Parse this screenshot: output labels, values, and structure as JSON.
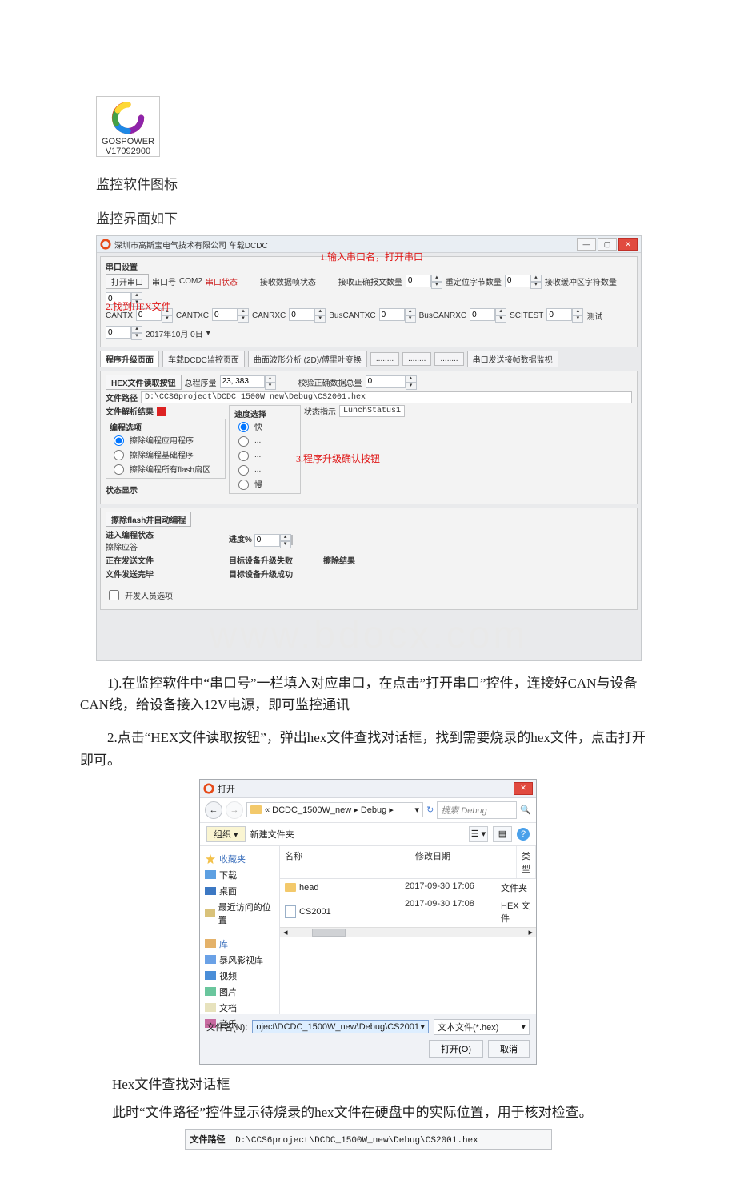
{
  "icon_card": {
    "name": "GOSPOWER",
    "version": "V17092900"
  },
  "headings": {
    "icon_caption": "监控软件图标",
    "ui_caption": "监控界面如下"
  },
  "app": {
    "title": "深圳市高斯宝电气技术有限公司 车载DCDC",
    "serial_group": "串口设置",
    "open_serial": "打开串口",
    "port_label": "串口号",
    "port_value": "COM2",
    "status_label": "串口状态",
    "rx_status": "接收数据帧状态",
    "rx_ok_bytes_lbl": "接收正确报文数量",
    "rx_ok_bytes_val": "0",
    "pos_bytes_lbl": "重定位字节数量",
    "pos_bytes_val": "0",
    "rx_buf_lbl": "接收缓冲区字符数量",
    "rx_buf_val": "0",
    "cantx_lbl": "CANTX",
    "cantx_val": "0",
    "cantxc_lbl": "CANTXC",
    "cantxc_val": "0",
    "canrxc_lbl": "CANRXC",
    "canrxc_val": "0",
    "buscantxc_lbl": "BusCANTXC",
    "buscantxc_val": "0",
    "buscanrxc_lbl": "BusCANRXC",
    "buscanrxc_val": "0",
    "scitest_lbl": "SCITEST",
    "scitest_val": "0",
    "test_lbl": "测试",
    "test_val": "0",
    "date_lbl": "2017年10月 0日",
    "tabs": [
      "程序升级页面",
      "车载DCDC监控页面",
      "曲面波形分析 (2D)/傅里叶变换",
      "........",
      "........",
      "........",
      "串口发送接帧数据监视"
    ],
    "hex_btn": "HEX文件读取按钮",
    "total_bytes_lbl": "总程序量",
    "total_bytes_val": "23, 383",
    "verify_ok_lbl": "校验正确数据总量",
    "verify_ok_val": "0",
    "file_path_lbl": "文件路径",
    "file_path_val": "D:\\CCS6project\\DCDC_1500W_new\\Debug\\CS2001.hex",
    "parse_result_lbl": "文件解析结果",
    "prog_select_grp": "编程选项",
    "opt_erase_app": "擦除编程应用程序",
    "opt_erase_base": "擦除编程基础程序",
    "opt_erase_all": "擦除编程所有flash扇区",
    "speed_grp": "速度选择",
    "speed_fast": "快",
    "speed_ellipsis": "...",
    "speed_slow": "慢",
    "state_lbl": "状态指示",
    "state_val": "LunchStatus1",
    "state_display": "状态显示",
    "confirm_btn": "擦除flash并自动编程",
    "enter_state": "进入编程状态",
    "erase_resp": "擦除应答",
    "sending": "正在发送文件",
    "send_done": "文件发送完毕",
    "fail": "目标设备升级失败",
    "fail_res": "擦除结果",
    "succ": "目标设备升级成功",
    "progress_lbl": "进度%",
    "progress_val": "0",
    "dev_opt": "开发人员选项"
  },
  "annot": {
    "a1": "1.输入串口名，打开串口",
    "a2": "2.找到HEX文件",
    "a3": "3.程序升级确认按钮"
  },
  "watermark": "www.bdocx.com",
  "body": {
    "p1": "1).在监控软件中“串口号”一栏填入对应串口，在点击”打开串口”控件，连接好CAN与设备CAN线，给设备接入12V电源，即可监控通讯",
    "p2": "2.点击“HEX文件读取按钮”，弹出hex文件查找对话框，找到需要烧录的hex文件，点击打开即可。",
    "caption_dlg": "Hex文件查找对话框",
    "p3": "此时“文件路径”控件显示待烧录的hex文件在硬盘中的实际位置，用于核对检查。"
  },
  "dlg": {
    "title": "打开",
    "crumbs": "« DCDC_1500W_new ▸ Debug ▸",
    "search_ph": "搜索 Debug",
    "organize": "组织 ▾",
    "newfolder": "新建文件夹",
    "cols": {
      "name": "名称",
      "date": "修改日期",
      "type": "类型"
    },
    "rows": [
      {
        "name": "head",
        "date": "2017-09-30 17:06",
        "type": "文件夹",
        "kind": "folder"
      },
      {
        "name": "CS2001",
        "date": "2017-09-30 17:08",
        "type": "HEX 文件",
        "kind": "file"
      }
    ],
    "nav": {
      "fav": "收藏夹",
      "dl": "下载",
      "desk": "桌面",
      "recent": "最近访问的位置",
      "lib": "库",
      "bf": "暴风影视库",
      "vid": "视频",
      "pic": "图片",
      "doc": "文档",
      "music": "音乐"
    },
    "fn_lbl": "文件名(N):",
    "fn_val": "oject\\DCDC_1500W_new\\Debug\\CS2001",
    "filter": "文本文件(*.hex)",
    "open": "打开(O)",
    "cancel": "取消"
  },
  "path_strip": {
    "lbl": "文件路径",
    "val": "D:\\CCS6project\\DCDC_1500W_new\\Debug\\CS2001.hex"
  }
}
